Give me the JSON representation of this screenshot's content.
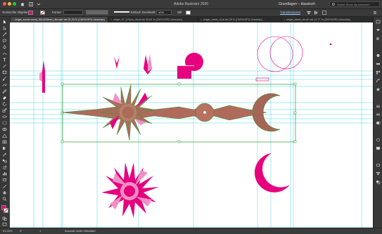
{
  "app": {
    "title": "Adobe Illustrator 2020",
    "workspace": "Grundlagen – klassisch",
    "search_placeholder": "Adobe Stock durchsuchen"
  },
  "control_bar": {
    "selection_label": "Gemischte Objekte",
    "stroke_label": "Kontur:",
    "stroke_style": "Einfach",
    "opacity_label": "Deckkraft:",
    "opacity_value": "40%",
    "style_label": "Stil:",
    "transform_label": "Transformieren",
    "fill_color": "#e6007e",
    "accent": "#e6007e"
  },
  "tabs": [
    {
      "label": "zeiger_sonne-mond_901x229mm_rtfo.eps* bei 31,25 % (CMYK/GPU-Vorschau)",
      "active": true
    },
    {
      "label": "zeiger_07_120cm_nfo.ai bei 33,63 % (CMYK/GPU-Vorschau)",
      "active": false
    },
    {
      "label": "zeiger_basel_v3.ai bei 25 % (CMYK/GPU-Vorschau)",
      "active": false
    },
    {
      "label": "zeiger_basel_nfo.ai* bei 12,77 % (CMYK/GPU-Vorschau)",
      "active": false
    }
  ],
  "status": {
    "zoom": "31,25%",
    "rotation": "0°",
    "artboard_nav": "1",
    "tool_name": "Auswahl stelle hilfsmitter"
  },
  "tools": [
    "selection-tool",
    "direct-selection-tool",
    "magic-wand-tool",
    "lasso-tool",
    "pen-tool",
    "curvature-tool",
    "type-tool",
    "line-tool",
    "rectangle-tool",
    "paintbrush-tool",
    "shaper-tool",
    "pencil-tool",
    "eraser-tool",
    "rotate-tool",
    "scale-tool",
    "width-tool",
    "free-transform-tool",
    "shape-builder-tool",
    "perspective-tool",
    "mesh-tool",
    "gradient-tool",
    "eyedropper-tool",
    "blend-tool",
    "symbol-sprayer-tool",
    "graph-tool",
    "artboard-tool",
    "slice-tool",
    "hand-tool",
    "zoom-tool"
  ],
  "panels": [
    "properties-panel",
    "layers-panel",
    "libraries-panel",
    "color-panel",
    "color-guide-panel",
    "swatches-panel",
    "brushes-panel",
    "symbols-panel",
    "stroke-panel",
    "gradient-panel",
    "transparency-panel",
    "appearance-panel",
    "graphic-styles-panel",
    "transform-panel",
    "align-panel",
    "pathfinder-panel"
  ],
  "colors": {
    "magenta": "#e6007e",
    "pink": "#f18fc4",
    "brown": "#9b5a4a",
    "guide": "#4fd6e4",
    "selection": "#2b9b2b"
  }
}
